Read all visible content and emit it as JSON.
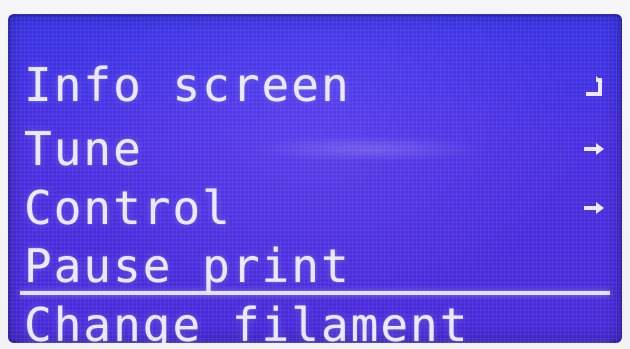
{
  "menu": {
    "items": [
      {
        "label": "Info screen",
        "icon": "back-icon"
      },
      {
        "label": "Tune",
        "icon": "chevron-right-icon"
      },
      {
        "label": "Control",
        "icon": "chevron-right-icon"
      },
      {
        "label": "Pause print",
        "icon": ""
      },
      {
        "label": "Change filament",
        "icon": "",
        "selected": true
      }
    ]
  },
  "colors": {
    "lcd_background": "#4a2fe0",
    "text": "#e9e9ff"
  }
}
